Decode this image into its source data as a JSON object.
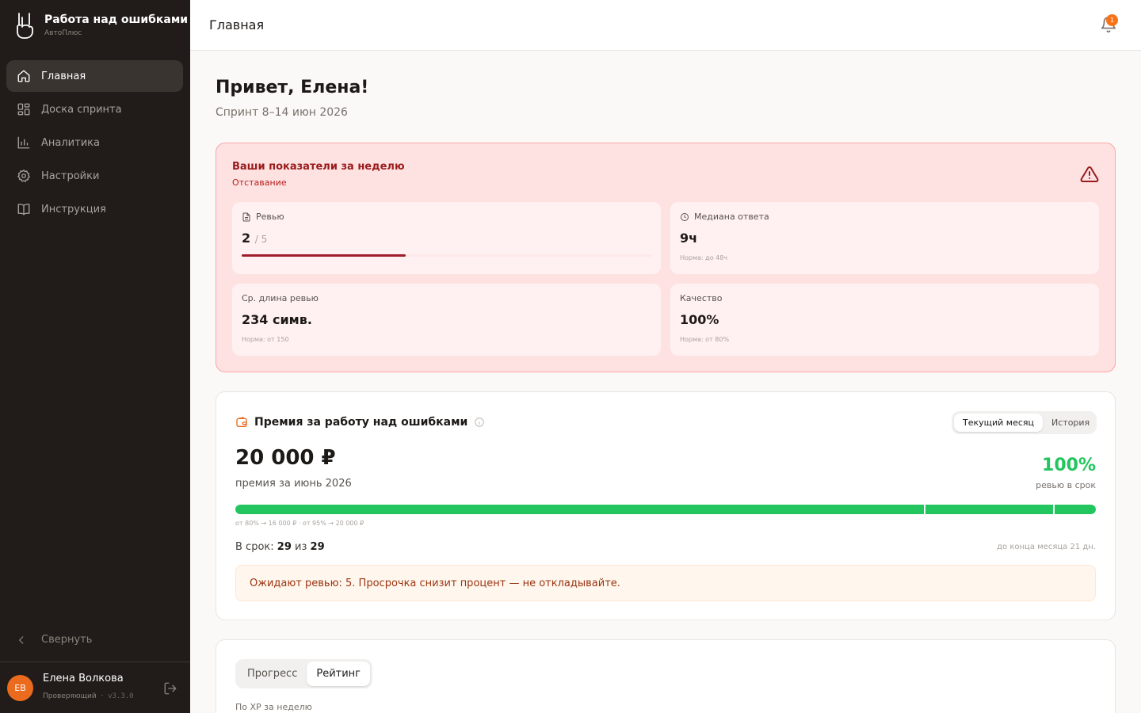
{
  "app": {
    "title": "Работа над ошибками",
    "subtitle": "АвтоПлюс"
  },
  "sidebar": {
    "items": [
      {
        "label": "Главная",
        "icon": "home-icon",
        "active": true
      },
      {
        "label": "Доска спринта",
        "icon": "board-icon"
      },
      {
        "label": "Аналитика",
        "icon": "chart-icon"
      },
      {
        "label": "Настройки",
        "icon": "gear-icon"
      },
      {
        "label": "Инструкция",
        "icon": "book-icon"
      }
    ],
    "collapse_label": "Свернуть"
  },
  "user": {
    "initials": "ЕВ",
    "name": "Елена Волкова",
    "role": "Проверяющий",
    "version": "v3.3.0"
  },
  "header": {
    "title": "Главная",
    "notifications": "1"
  },
  "main": {
    "greeting": "Привет, Елена!",
    "sprint": "Спринт 8–14 июн 2026"
  },
  "weekly": {
    "title": "Ваши показатели за неделю",
    "status": "Отставание",
    "reviews": {
      "label": "Ревью",
      "value": "2",
      "of": "/ 5",
      "progress": 0.4
    },
    "median": {
      "label": "Медиана ответа",
      "value": "9ч",
      "norm": "Норма: до 48ч"
    },
    "avg_length": {
      "label": "Ср. длина ревью",
      "value": "234 симв.",
      "norm": "Норма: от 150"
    },
    "quality": {
      "label": "Качество",
      "value": "100%",
      "norm": "Норма: от 80%"
    }
  },
  "bonus": {
    "title": "Премия за работу над ошибками",
    "tabs": [
      "Текущий месяц",
      "История"
    ],
    "amount": "20 000 ₽",
    "amount_caption": "премия за июнь 2026",
    "percent": "100%",
    "percent_caption": "ревью в срок",
    "progress": 1.0,
    "thresholds_text": "от 80% → 16 000 ₽ · от 95% → 20 000 ₽",
    "thresholds": [
      0.8,
      0.95
    ],
    "ontime_prefix": "В срок:",
    "ontime_done": "29",
    "ontime_mid": "из",
    "ontime_total": "29",
    "days_left": "до конца месяца 21 дн.",
    "notice": "Ожидают ревью: 5. Просрочка снизит процент — не откладывайте."
  },
  "rating": {
    "tabs": [
      "Прогресс",
      "Рейтинг"
    ],
    "active_tab": "Рейтинг",
    "subtitle": "По XP за неделю"
  },
  "colors": {
    "sidebar": "#211c19",
    "accent": "#ea6a1e",
    "danger": "#991b1b",
    "success": "#22c55e"
  }
}
